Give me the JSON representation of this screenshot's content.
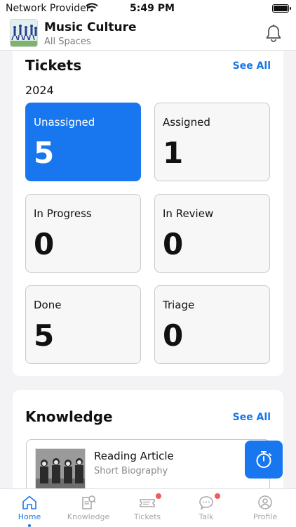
{
  "status_bar": {
    "carrier": "Network Provider",
    "time": "5:49 PM"
  },
  "header": {
    "title": "Music Culture",
    "subtitle": "All Spaces",
    "icon": "bell-icon"
  },
  "tickets": {
    "title": "Tickets",
    "see_all": "See All",
    "year": "2024",
    "tiles": [
      {
        "label": "Unassigned",
        "count": "5"
      },
      {
        "label": "Assigned",
        "count": "1"
      },
      {
        "label": "In Progress",
        "count": "0"
      },
      {
        "label": "In Review",
        "count": "0"
      },
      {
        "label": "Done",
        "count": "5"
      },
      {
        "label": "Triage",
        "count": "0"
      }
    ]
  },
  "knowledge": {
    "title": "Knowledge",
    "see_all": "See All",
    "article": {
      "title": "Reading Article",
      "subtitle": "Short Biography"
    }
  },
  "fab": {
    "icon": "stopwatch-icon"
  },
  "tabbar": {
    "items": [
      {
        "label": "Home",
        "icon": "home-icon"
      },
      {
        "label": "Knowledge",
        "icon": "knowledge-icon"
      },
      {
        "label": "Tickets",
        "icon": "ticket-icon"
      },
      {
        "label": "Talk",
        "icon": "chat-icon"
      },
      {
        "label": "Profile",
        "icon": "profile-icon"
      }
    ]
  },
  "colors": {
    "accent": "#1877ee",
    "notification": "#f25a5a",
    "muted": "#a6a6aa"
  }
}
